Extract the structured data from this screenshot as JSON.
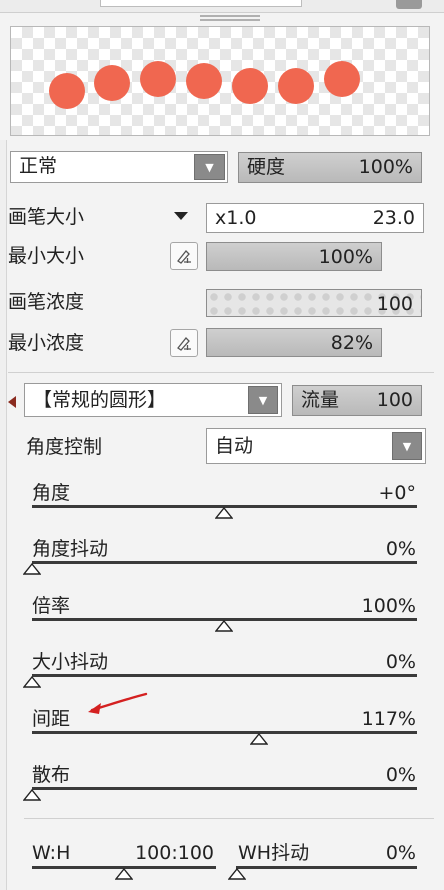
{
  "brush": {
    "mode": "正常",
    "hardness_label": "硬度",
    "hardness_value": "100%",
    "pen_size_label": "画笔大小",
    "pen_size_multiplier": "x1.0",
    "pen_size_value": "23.0",
    "min_size_label": "最小大小",
    "min_size_value": "100%",
    "density_label": "画笔浓度",
    "density_value": "100",
    "min_density_label": "最小浓度",
    "min_density_value": "82%"
  },
  "shape": {
    "preset": "【常规的圆形】",
    "flow_label": "流量",
    "flow_value": "100",
    "angle_control_label": "角度控制",
    "angle_control_value": "自动"
  },
  "sliders": [
    {
      "label": "角度",
      "value": "+0°",
      "fraction": 0.5
    },
    {
      "label": "角度抖动",
      "value": "0%",
      "fraction": 0
    },
    {
      "label": "倍率",
      "value": "100%",
      "fraction": 0.5
    },
    {
      "label": "大小抖动",
      "value": "0%",
      "fraction": 0
    },
    {
      "label": "间距",
      "value": "117%",
      "fraction": 0.59
    },
    {
      "label": "散布",
      "value": "0%",
      "fraction": 0
    }
  ],
  "ratio": {
    "wh_label": "W:H",
    "wh_value": "100:100",
    "wh_fraction": 0.5,
    "wh_jitter_label": "WH抖动",
    "wh_jitter_value": "0%",
    "wh_jitter_fraction": 0
  },
  "colors": {
    "preview_dot": "#f06750",
    "annotation_arrow": "#d42020"
  }
}
